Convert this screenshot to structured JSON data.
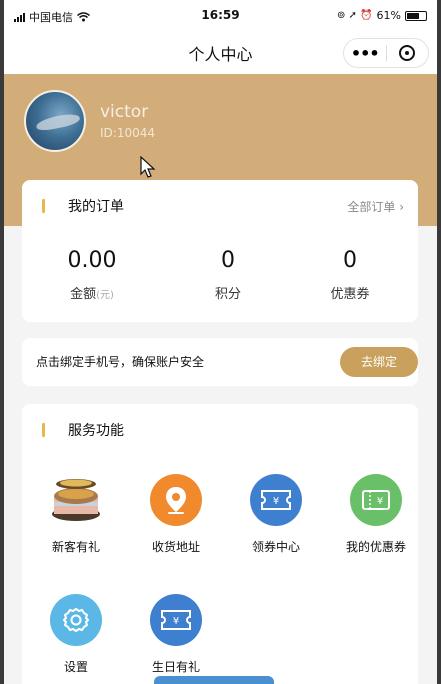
{
  "status_bar": {
    "carrier": "中国电信",
    "time": "16:59",
    "battery": "61%"
  },
  "nav": {
    "title": "个人中心",
    "more_icon": "more-dots-icon",
    "close_icon": "close-circle-icon"
  },
  "profile": {
    "username": "victor",
    "user_id": "ID:10044"
  },
  "orders": {
    "title": "我的订单",
    "all_link": "全部订单",
    "stats": [
      {
        "value": "0.00",
        "label": "金额",
        "unit": "(元)"
      },
      {
        "value": "0",
        "label": "积分"
      },
      {
        "value": "0",
        "label": "优惠券"
      }
    ]
  },
  "bind": {
    "text": "点击绑定手机号，确保账户安全",
    "button": "去绑定"
  },
  "services": {
    "title": "服务功能",
    "items": [
      {
        "label": "新客有礼",
        "icon": "gift-cake-icon"
      },
      {
        "label": "收货地址",
        "icon": "location-pin-icon",
        "color": "#f08a2c"
      },
      {
        "label": "领券中心",
        "icon": "coupon-ticket-icon",
        "color": "#3f7fcf"
      },
      {
        "label": "我的优惠券",
        "icon": "my-coupon-icon",
        "color": "#6abf69"
      },
      {
        "label": "设置",
        "icon": "settings-gear-icon",
        "color": "#5bb8e6"
      },
      {
        "label": "生日有礼",
        "icon": "birthday-ticket-icon",
        "color": "#3f7fcf"
      }
    ]
  },
  "colors": {
    "header": "#d2ad7a",
    "accent": "#c9a15c",
    "title_bar": "#e6b94a"
  }
}
